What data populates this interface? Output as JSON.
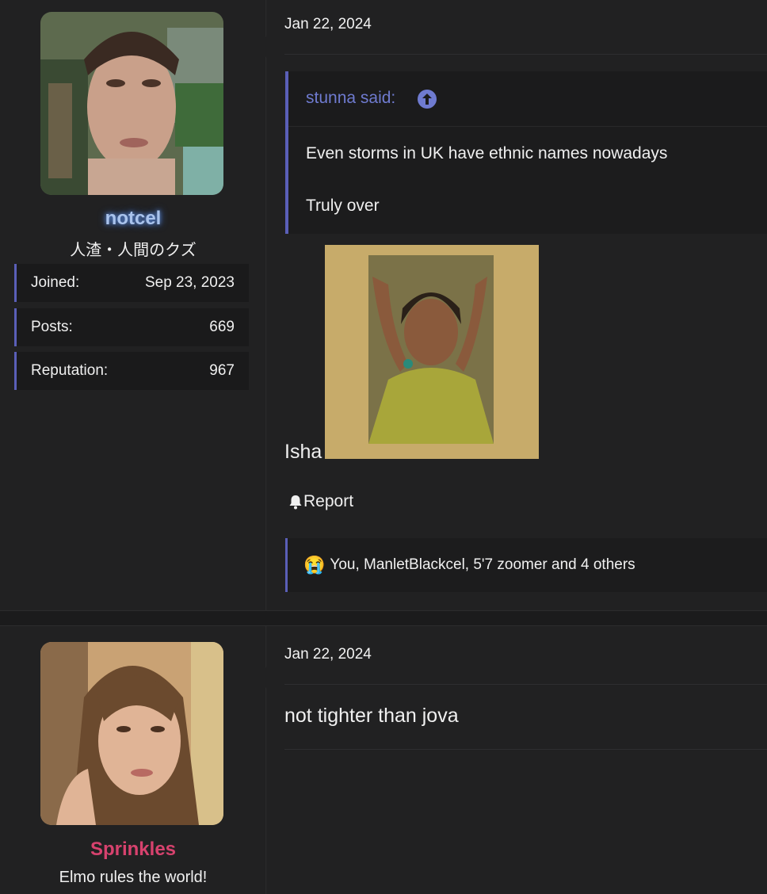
{
  "posts": [
    {
      "user": {
        "name": "notcel",
        "title": "人渣・人間のクズ",
        "stats": [
          {
            "label": "Joined:",
            "value": "Sep 23, 2023"
          },
          {
            "label": "Posts:",
            "value": "669"
          },
          {
            "label": "Reputation:",
            "value": "967"
          }
        ]
      },
      "date": "Jan 22, 2024",
      "quote": {
        "author": "stunna said:",
        "lines": [
          "Even storms in UK have ethnic names nowadays",
          "Truly over"
        ]
      },
      "message": "Isha",
      "report_label": "Report",
      "reactions": {
        "emoji": "😭",
        "text": "You, ManletBlackcel, 5'7 zoomer and 4 others"
      }
    },
    {
      "user": {
        "name": "Sprinkles",
        "title": "Elmo rules the world!"
      },
      "date": "Jan 22, 2024",
      "message": "not tighter than jova"
    }
  ],
  "colors": {
    "accent": "#5a5fb8",
    "quote_author": "#6f7bd0",
    "username_blue": "#a9c3ec",
    "username_pink": "#d7426e"
  }
}
